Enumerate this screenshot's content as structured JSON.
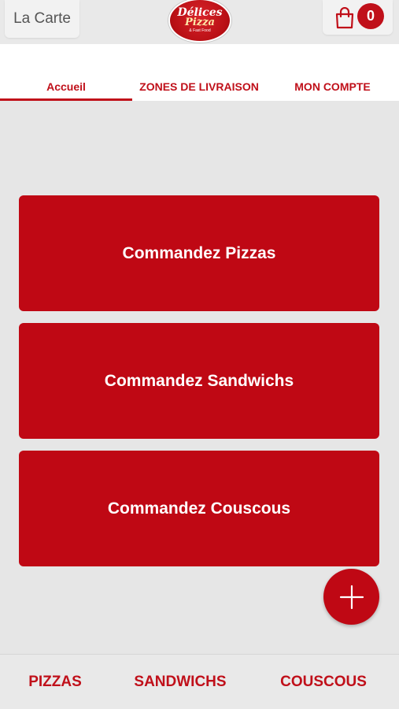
{
  "header": {
    "menu_label": "La Carte",
    "logo": {
      "line1": "Délices",
      "line2": "Pizza",
      "line3": "& Fast Food",
      "icon": "restaurant-logo"
    },
    "cart": {
      "icon": "shopping-bag-icon",
      "count": "0"
    }
  },
  "tabs": [
    {
      "label": "Accueil",
      "active": true
    },
    {
      "label": "ZONES DE LIVRAISON",
      "active": false
    },
    {
      "label": "MON COMPTE",
      "active": false
    }
  ],
  "cards": [
    {
      "label": "Commandez Pizzas"
    },
    {
      "label": "Commandez Sandwichs"
    },
    {
      "label": "Commandez Couscous"
    }
  ],
  "fab": {
    "icon": "plus-icon"
  },
  "bottom_nav": [
    {
      "label": "PIZZAS"
    },
    {
      "label": "SANDWICHS"
    },
    {
      "label": "COUSCOUS"
    }
  ],
  "colors": {
    "brand_red": "#bf0814",
    "accent_red": "#c0101a",
    "background": "#e6e6e6"
  }
}
